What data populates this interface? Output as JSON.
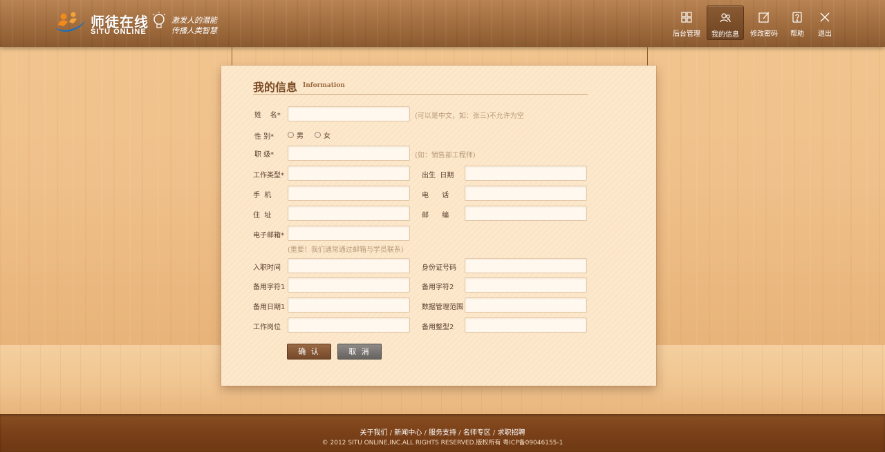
{
  "brand": {
    "name_cn": "师徒在线",
    "name_en": "SITU ONLINE",
    "slogan_line1": "激发人的潜能",
    "slogan_line2": "传播人类智慧"
  },
  "nav": [
    {
      "label": "后台管理",
      "icon": "grid-icon",
      "active": false
    },
    {
      "label": "我的信息",
      "icon": "users-icon",
      "active": true
    },
    {
      "label": "修改密码",
      "icon": "edit-icon",
      "active": false
    },
    {
      "label": "帮助",
      "icon": "help-icon",
      "active": false
    },
    {
      "label": "退出",
      "icon": "close-icon",
      "active": false
    }
  ],
  "panel": {
    "title": "我的信息",
    "subtitle": "Information"
  },
  "form": {
    "name_label": "姓    名*",
    "name_hint": "(可以是中文，如：张三)不允许为空",
    "gender_label": "性 别*",
    "gender_options": [
      "男",
      "女"
    ],
    "title_label": "职 级*",
    "title_hint": "(如：销售部工程师)",
    "worktype_label": "工作类型*",
    "birthdate_label": "出生  日期",
    "mobile_label": "手  机",
    "phone_label": "电      话",
    "address_label": "住  址",
    "zipcode_label": "邮      编",
    "email_label": "电子邮箱*",
    "email_hint": "(重要！我们通常通过邮箱与学员联系)",
    "hire_date_label": "入职时间",
    "id_number_label": "身份证号码",
    "spare_char1_label": "备用字符1",
    "spare_char2_label": "备用字符2",
    "spare_date1_label": "备用日期1",
    "data_scope_label": "数据管理范围",
    "position_label": "工作岗位",
    "spare_int2_label": "备用整型2",
    "confirm": "确 认",
    "cancel": "取 消"
  },
  "footer": {
    "links": [
      "关于我们",
      "新闻中心",
      "服务支持",
      "名师专区",
      "求职招聘"
    ],
    "copyright": "© 2012 SITU ONLINE,INC.ALL RIGHTS RESERVED.版权所有 粤ICP备09046155-1"
  }
}
